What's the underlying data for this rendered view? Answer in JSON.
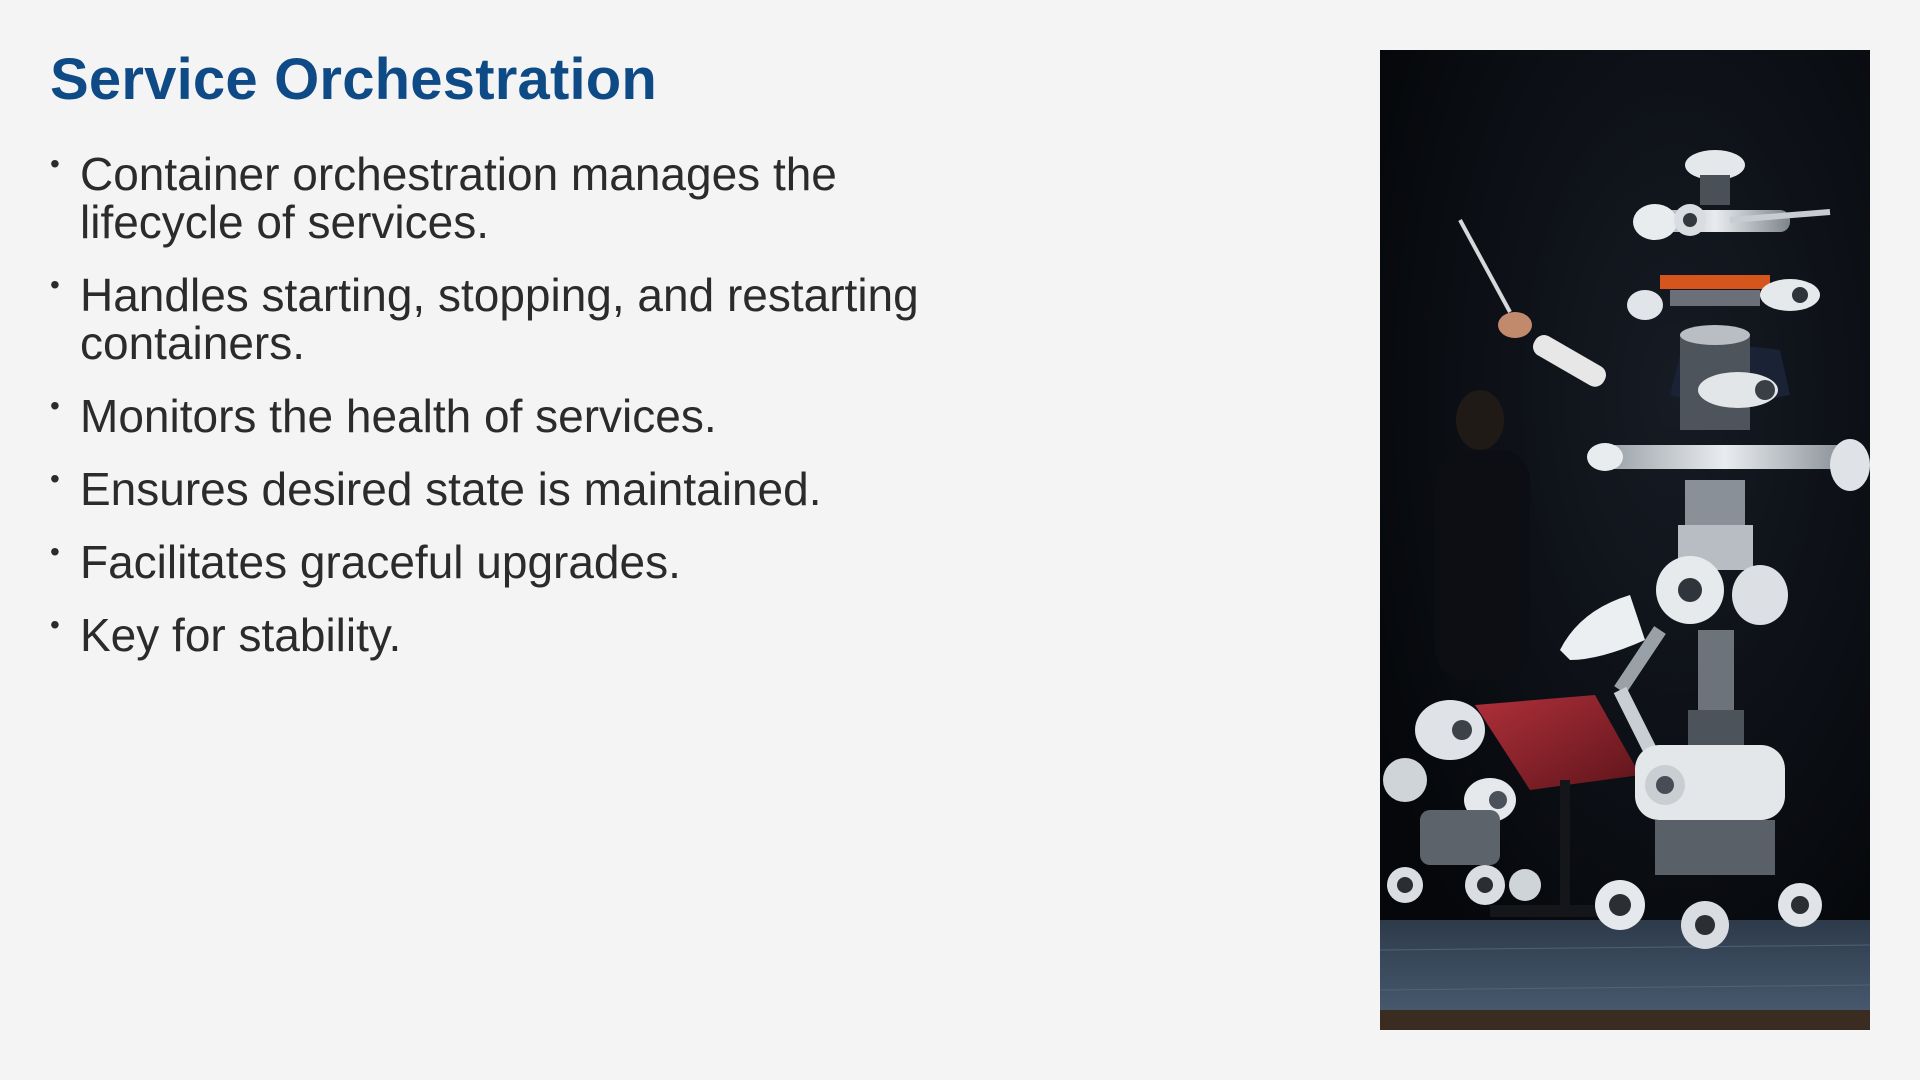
{
  "slide": {
    "title": "Service Orchestration",
    "bullets": [
      "Container orchestration manages the lifecycle of services.",
      "Handles starting, stopping, and restarting containers.",
      "Monitors the health of services.",
      "Ensures desired state is maintained.",
      "Facilitates graceful upgrades.",
      "Key for stability."
    ],
    "bullet_glyph": "•"
  },
  "image": {
    "subject": "robot conductor with baton leading smaller robots on a dark stage",
    "colors": {
      "background": "#06080c",
      "robot_body": "#d9dde2",
      "robot_dark": "#5a6068",
      "accent_orange": "#d4561c",
      "music_stand": "#8e1f27",
      "stage_floor": "#3a4a5c"
    }
  },
  "theme": {
    "title_color": "#0e4a86",
    "text_color": "#2b2b2b",
    "page_background": "#f4f4f4"
  }
}
